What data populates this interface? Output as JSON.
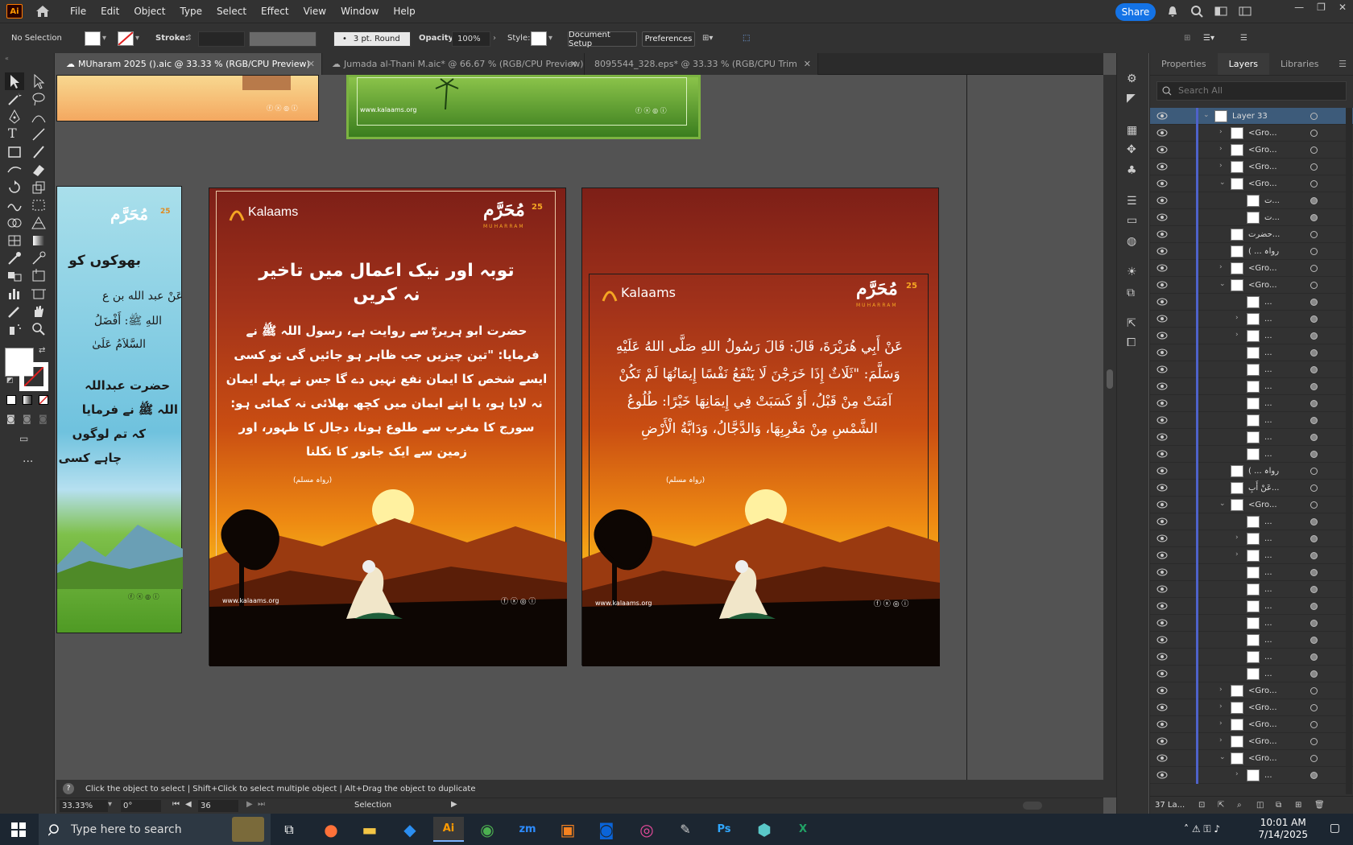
{
  "app": {
    "logo": "Ai",
    "menus": [
      "File",
      "Edit",
      "Object",
      "Type",
      "Select",
      "Effect",
      "View",
      "Window",
      "Help"
    ],
    "share_label": "Share"
  },
  "control": {
    "selection": "No Selection",
    "stroke_label": "Stroke:",
    "brush": "3 pt. Round",
    "opacity_label": "Opacity:",
    "opacity": "100%",
    "style_label": "Style:",
    "doc_setup": "Document Setup",
    "preferences": "Preferences"
  },
  "tabs": [
    {
      "label": "MUharam 2025 ().aic @ 33.33 % (RGB/CPU Preview)",
      "active": true
    },
    {
      "label": "Jumada al-Thani M.aic* @ 66.67 % (RGB/CPU Preview)",
      "active": false
    },
    {
      "label": "8095544_328.eps* @ 33.33 % (RGB/CPU Trim View)",
      "active": false
    }
  ],
  "artboards": {
    "top_site": "www.kalaams.org",
    "left_title_partial": "بھوکوں کو",
    "left_arabic_partial": "عَنْ عبد الله بن ع",
    "left_arabic2": "اللهِ ﷺ: أَفْضَلُ",
    "left_arabic3": "السَّلاَمُ عَلَىٰ",
    "left_urdu1": "حضرت عبداللہ",
    "left_urdu2": "اللہ ﷺ نے فرمایا",
    "left_urdu3": "کہ تم لوگوں",
    "left_urdu4": "چاہے کسی",
    "brand": "Kalaams",
    "muharram": "مُحَرَّم",
    "muharram_latin": "MUHARRAM",
    "year": "25",
    "main_title_1": "توبہ اور نیک اعمال میں تاخیر",
    "main_title_2": "نہ کریں",
    "main_body": "حضرت ابو ہریرہؓ سے روایت ہے، رسول اللہ ﷺ نے فرمایا: \"تین چیزیں جب ظاہر ہو جائیں گی تو کسی ایسے شخص کا ایمان نفع نہیں دے گا جس نے پہلے ایمان نہ لایا ہو، یا اپنے ایمان میں کچھ بھلائی نہ کمائی ہو: سورج کا مغرب سے طلوع ہونا، دجال کا ظہور، اور زمین سے ایک جانور کا نکلنا",
    "reference": "(رواہ مسلم)",
    "arabic_body": "عَنْ أَبِي هُرَيْرَةَ، قَالَ: قَالَ رَسُولُ اللهِ صَلَّى اللهُ عَلَيْهِ وَسَلَّمَ: \"ثَلَاثٌ إِذَا خَرَجْنَ لَا يَنْفَعُ نَفْسًا إِيمَانُهَا لَمْ تَكُنْ آمَنَتْ مِنْ قَبْلُ، أَوْ كَسَبَتْ فِي إِيمَانِهَا خَيْرًا: طُلُوعُ الشَّمْسِ مِنْ مَغْرِبِهَا، وَالدَّجَّالُ، وَدَابَّةُ الْأَرْضِ",
    "site": "www.kalaams.org"
  },
  "status": {
    "hint": "Click the object to select  |  Shift+Click to select multiple object  |  Alt+Drag the object to duplicate",
    "zoom": "33.33%",
    "rotation": "0°",
    "artboard_no": "36",
    "tool": "Selection"
  },
  "panel": {
    "tabs": [
      "Properties",
      "Layers",
      "Libraries"
    ],
    "search_placeholder": "Search All",
    "layers": [
      {
        "name": "Layer 33",
        "level": 0,
        "chev": "v",
        "sel": true
      },
      {
        "name": "<Gro...",
        "level": 1,
        "chev": ">"
      },
      {
        "name": "<Gro...",
        "level": 1,
        "chev": ">"
      },
      {
        "name": "<Gro...",
        "level": 1,
        "chev": ">"
      },
      {
        "name": "<Gro...",
        "level": 1,
        "chev": "v"
      },
      {
        "name": "ت...",
        "level": 2,
        "chev": ""
      },
      {
        "name": "ت...",
        "level": 2,
        "chev": ""
      },
      {
        "name": "حضرت...",
        "level": 1,
        "chev": ""
      },
      {
        "name": "( ... رواہ",
        "level": 1,
        "chev": ""
      },
      {
        "name": "<Gro...",
        "level": 1,
        "chev": ">"
      },
      {
        "name": "<Gro...",
        "level": 1,
        "chev": "v"
      },
      {
        "name": "...",
        "level": 2,
        "chev": ""
      },
      {
        "name": "...",
        "level": 2,
        "chev": ">"
      },
      {
        "name": "...",
        "level": 2,
        "chev": ">"
      },
      {
        "name": "...",
        "level": 2,
        "chev": ""
      },
      {
        "name": "...",
        "level": 2,
        "chev": ""
      },
      {
        "name": "...",
        "level": 2,
        "chev": ""
      },
      {
        "name": "...",
        "level": 2,
        "chev": ""
      },
      {
        "name": "...",
        "level": 2,
        "chev": ""
      },
      {
        "name": "...",
        "level": 2,
        "chev": ""
      },
      {
        "name": "...",
        "level": 2,
        "chev": ""
      },
      {
        "name": "( ... رواہ",
        "level": 1,
        "chev": ""
      },
      {
        "name": "عَنْ أَبِ...",
        "level": 1,
        "chev": ""
      },
      {
        "name": "<Gro...",
        "level": 1,
        "chev": "v"
      },
      {
        "name": "...",
        "level": 2,
        "chev": ""
      },
      {
        "name": "...",
        "level": 2,
        "chev": ">"
      },
      {
        "name": "...",
        "level": 2,
        "chev": ">"
      },
      {
        "name": "...",
        "level": 2,
        "chev": ""
      },
      {
        "name": "...",
        "level": 2,
        "chev": ""
      },
      {
        "name": "...",
        "level": 2,
        "chev": ""
      },
      {
        "name": "...",
        "level": 2,
        "chev": ""
      },
      {
        "name": "...",
        "level": 2,
        "chev": ""
      },
      {
        "name": "...",
        "level": 2,
        "chev": ""
      },
      {
        "name": "...",
        "level": 2,
        "chev": ""
      },
      {
        "name": "<Gro...",
        "level": 1,
        "chev": ">"
      },
      {
        "name": "<Gro...",
        "level": 1,
        "chev": ">"
      },
      {
        "name": "<Gro...",
        "level": 1,
        "chev": ">"
      },
      {
        "name": "<Gro...",
        "level": 1,
        "chev": ">"
      },
      {
        "name": "<Gro...",
        "level": 1,
        "chev": "v"
      },
      {
        "name": "...",
        "level": 2,
        "chev": ">"
      }
    ],
    "footer": "37 La..."
  },
  "taskbar": {
    "search": "Type here to search",
    "time": "10:01 AM",
    "date": "7/14/2025"
  }
}
